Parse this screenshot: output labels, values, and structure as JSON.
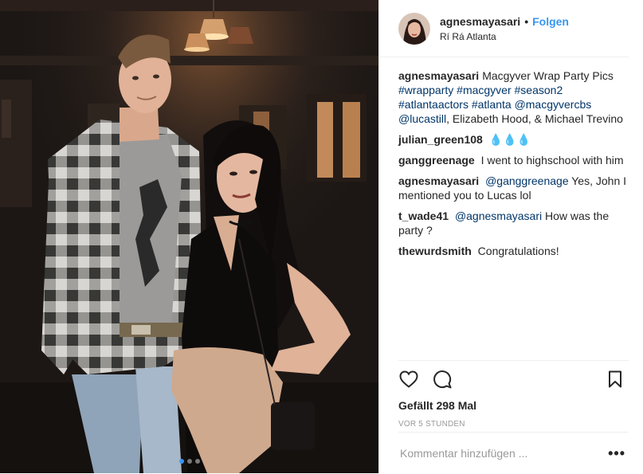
{
  "post": {
    "username": "agnesmayasari",
    "separator": "•",
    "follow_label": "Folgen",
    "location": "Rí Rá Atlanta"
  },
  "caption": {
    "user": "agnesmayasari",
    "text": "Macgyver Wrap Party Pics",
    "tags": [
      "#wrapparty",
      "#macgyver",
      "#season2",
      "#atlantaactors",
      "#atlanta",
      "@macgyvercbs",
      "@lucastill"
    ],
    "tail": ", Elizabeth Hood, & Michael Trevino"
  },
  "comments": [
    {
      "user": "julian_green108",
      "text": "💧💧💧"
    },
    {
      "user": "ganggreenage",
      "text": "I went to highschool with him"
    },
    {
      "user": "agnesmayasari",
      "mention": "@ganggreenage",
      "text": "Yes, John I mentioned you to Lucas lol"
    },
    {
      "user": "t_wade41",
      "mention": "@agnesmayasari",
      "text": "How was the party ?"
    },
    {
      "user": "thewurdsmith",
      "text": "Congratulations!"
    }
  ],
  "actions": {
    "like_icon": "heart-icon",
    "comment_icon": "comment-bubble-icon",
    "save_icon": "bookmark-icon",
    "likes_text": "Gefällt 298 Mal",
    "time_text": "VOR 5 STUNDEN"
  },
  "comment_box": {
    "placeholder": "Kommentar hinzufügen ...",
    "more_label": "•••"
  },
  "carousel": {
    "count": 3,
    "active_index": 0
  },
  "colors": {
    "link": "#3897f0",
    "hashtag": "#003569",
    "muted": "#999999"
  }
}
